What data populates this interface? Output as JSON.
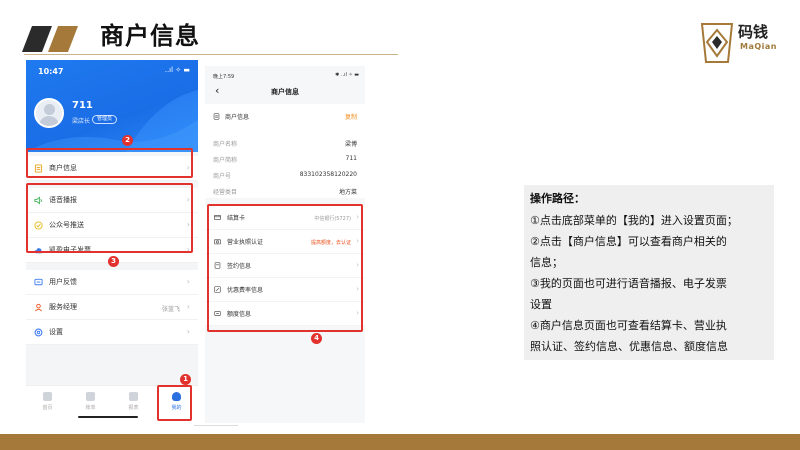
{
  "slide": {
    "title": "商户信息",
    "logo_cn": "码钱",
    "logo_en": "MaQian",
    "colors": {
      "accent_dark": "#2b2b2b",
      "accent_gold": "#a5793a",
      "annotation_red": "#e2322d"
    }
  },
  "phone_left": {
    "status_time": "10:47",
    "status_icons": "..ıl ✧ ▬",
    "user_name": "711",
    "user_role": "梁店长",
    "user_tag": "管理员",
    "menu_group1": [
      {
        "label": "商户信息",
        "icon": "document-icon"
      }
    ],
    "menu_group2": [
      {
        "label": "语音播报",
        "icon": "speaker-icon"
      },
      {
        "label": "公众号推送",
        "icon": "check-circle-icon"
      },
      {
        "label": "凯盈电子发票",
        "icon": "cloud-icon"
      }
    ],
    "menu_group3": [
      {
        "label": "用户反馈",
        "icon": "feedback-icon",
        "value": ""
      },
      {
        "label": "服务经理",
        "icon": "person-icon",
        "value": "张蓝飞"
      },
      {
        "label": "设置",
        "icon": "gear-icon",
        "value": ""
      }
    ],
    "tabs": [
      {
        "label": "首页",
        "active": false
      },
      {
        "label": "账单",
        "active": false
      },
      {
        "label": "报表",
        "active": false
      },
      {
        "label": "我的",
        "active": true
      }
    ]
  },
  "phone_right": {
    "status_time": "晚上7:59",
    "status_icons": "✱ ..ıl ✧ ▬",
    "title": "商户信息",
    "info_section": "商户信息",
    "copy_label": "复制",
    "info_rows": [
      {
        "label": "商户名称",
        "value": "梁博"
      },
      {
        "label": "商户简称",
        "value": "711"
      },
      {
        "label": "商户号",
        "value": "833102358120220"
      },
      {
        "label": "经营类目",
        "value": "地方菜"
      }
    ],
    "items": [
      {
        "label": "结算卡",
        "value": "中信银行(5727)",
        "warn": false,
        "icon": "card-icon"
      },
      {
        "label": "营业执照认证",
        "value": "提高额度，去认证",
        "warn": true,
        "icon": "camera-icon"
      },
      {
        "label": "签约信息",
        "value": "",
        "warn": false,
        "icon": "contract-icon"
      },
      {
        "label": "优惠费率信息",
        "value": "",
        "warn": false,
        "icon": "discount-icon"
      },
      {
        "label": "额度信息",
        "value": "",
        "warn": false,
        "icon": "quota-icon"
      }
    ]
  },
  "markers": [
    "1",
    "2",
    "3",
    "4"
  ],
  "note": {
    "title": "操作路径：",
    "lines": [
      "①点击底部菜单的【我的】进入设置页面；",
      "②点击【商户信息】可以查看商户相关的",
      "信息；",
      "③我的页面也可进行语音播报、电子发票",
      "设置",
      "④商户信息页面也可查看结算卡、营业执",
      "照认证、签约信息、优惠信息、额度信息"
    ]
  }
}
